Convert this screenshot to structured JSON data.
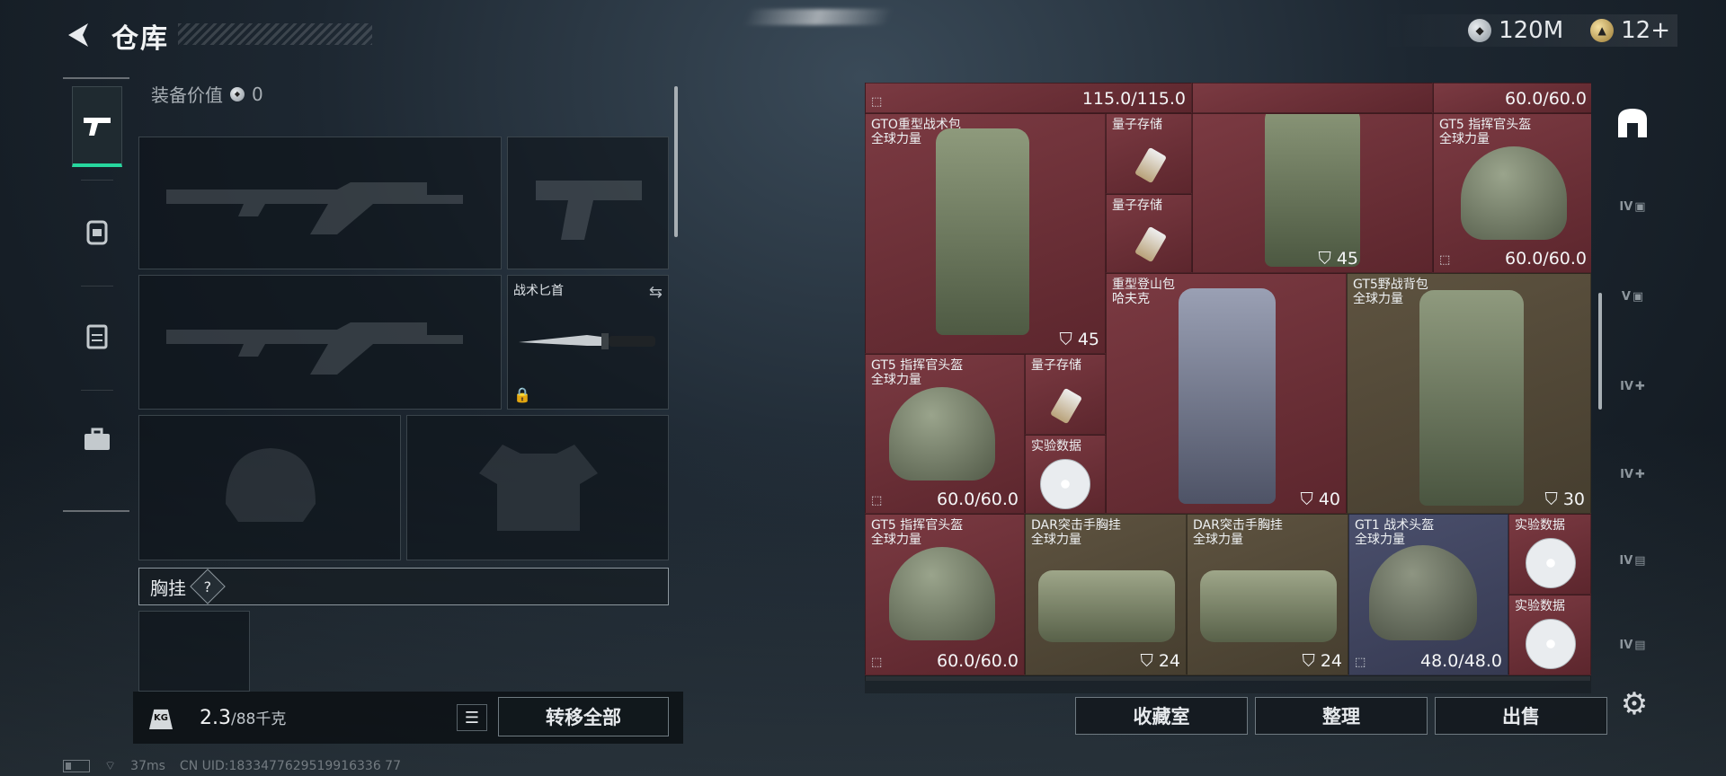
{
  "header": {
    "title": "仓库"
  },
  "currency": {
    "silver": "120M",
    "gold": "12+"
  },
  "left_tabs": [
    "weapons",
    "backpack",
    "armor",
    "toolbox"
  ],
  "equipment": {
    "value_label": "装备价值",
    "value": "0",
    "knife_label": "战术匕首",
    "chest_label": "胸挂",
    "help": "?"
  },
  "bottom": {
    "weight": "2.3",
    "weight_max": "/88千克",
    "weight_icon": "KG",
    "transfer_label": "转移全部"
  },
  "status": {
    "ping": "37ms",
    "uid": "CN UID:1833477629519916336 77"
  },
  "stash": {
    "top_row": {
      "left_val": "115.0/115.0",
      "right_val": "60.0/60.0"
    },
    "items": [
      {
        "name": "GTO重型战术包",
        "sub": "全球力量",
        "num": "45"
      },
      {
        "name": "量子存储",
        "sub": ""
      },
      {
        "name": "量子存储",
        "sub": ""
      },
      {
        "name": "GT5 指挥官头盔",
        "sub": "全球力量",
        "val": "60.0/60.0"
      },
      {
        "name": "",
        "sub": "",
        "num": "45"
      },
      {
        "name": "重型登山包",
        "sub": "哈夫克",
        "num": "40"
      },
      {
        "name": "GT5野战背包",
        "sub": "全球力量",
        "num": "30"
      },
      {
        "name": "GT5 指挥官头盔",
        "sub": "全球力量",
        "val": "60.0/60.0"
      },
      {
        "name": "量子存储",
        "sub": ""
      },
      {
        "name": "实验数据",
        "sub": ""
      },
      {
        "name": "GT5 指挥官头盔",
        "sub": "全球力量",
        "val": "60.0/60.0"
      },
      {
        "name": "DAR突击手胸挂",
        "sub": "全球力量",
        "num": "24"
      },
      {
        "name": "DAR突击手胸挂",
        "sub": "全球力量",
        "num": "24"
      },
      {
        "name": "GT1 战术头盔",
        "sub": "全球力量",
        "val": "48.0/48.0"
      },
      {
        "name": "实验数据",
        "sub": ""
      },
      {
        "name": "实验数据",
        "sub": ""
      }
    ]
  },
  "actions": [
    "收藏室",
    "整理",
    "出售"
  ],
  "right_rail": [
    "IV",
    "V",
    "IV",
    "IV",
    "IV",
    "IV"
  ]
}
